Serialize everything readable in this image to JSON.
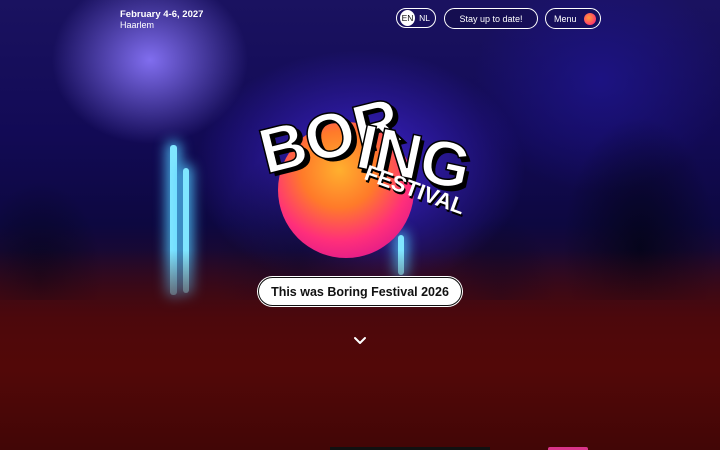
{
  "event": {
    "date": "February 4-6, 2027",
    "city": "Haarlem"
  },
  "language": {
    "options": [
      "EN",
      "NL"
    ],
    "selected": "EN"
  },
  "header": {
    "stay_label": "Stay up to date!",
    "menu_label": "Menu"
  },
  "logo": {
    "word1": "BOR",
    "word2": "ING",
    "word3": "FESTIVAL"
  },
  "hero": {
    "cta_label": "This was Boring Festival 2026"
  },
  "colors": {
    "accent_orange": "#ff8a2a",
    "accent_pink": "#ff2f7a",
    "background_red": "#4a0808",
    "background_blue": "#1a1260"
  },
  "icons": {
    "scroll": "chevron-down-icon",
    "menu": "sun-dot-icon"
  }
}
